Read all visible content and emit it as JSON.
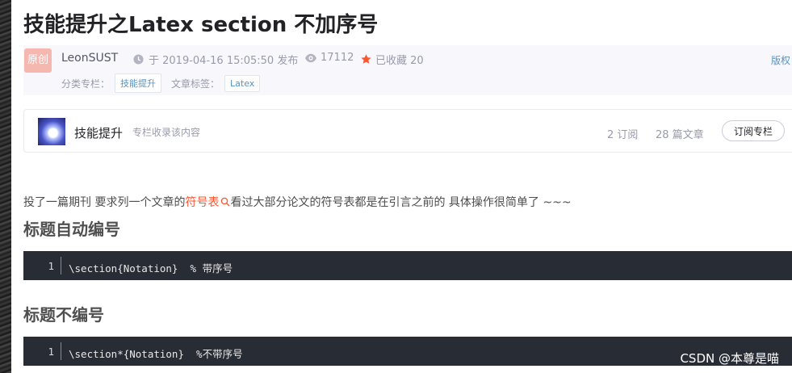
{
  "title": "技能提升之Latex section 不加序号",
  "meta": {
    "badge": "原创",
    "author": "LeonSUST",
    "published": "于 2019-04-16 15:05:50 发布",
    "views": "17112",
    "favorites": "已收藏 20",
    "copyright": "版权",
    "category_label": "分类专栏：",
    "category_tag": "技能提升",
    "tags_label": "文章标签：",
    "tag": "Latex"
  },
  "column": {
    "name": "技能提升",
    "desc": "专栏收录该内容",
    "subscribers": "2 订阅",
    "articles": "28 篇文章",
    "subscribe": "订阅专栏"
  },
  "body": {
    "intro_before": "投了一篇期刊 要求列一个文章的 ",
    "keyword": "符号表",
    "intro_after": " 看过大部分论文的符号表都是在引言之前的 具体操作很简单了 ~~~",
    "heading1": "标题自动编号",
    "code1": {
      "line": "1",
      "text": "\\section{Notation}  % 带序号"
    },
    "heading2": "标题不编号",
    "code2": {
      "line": "1",
      "text": "\\section*{Notation}  %不带序号"
    }
  },
  "watermark": "CSDN @本尊是喵",
  "colors": {
    "accent": "#fc5531",
    "link": "#5893c2",
    "code_bg": "#282c34",
    "badge": "#f6b7b0"
  }
}
